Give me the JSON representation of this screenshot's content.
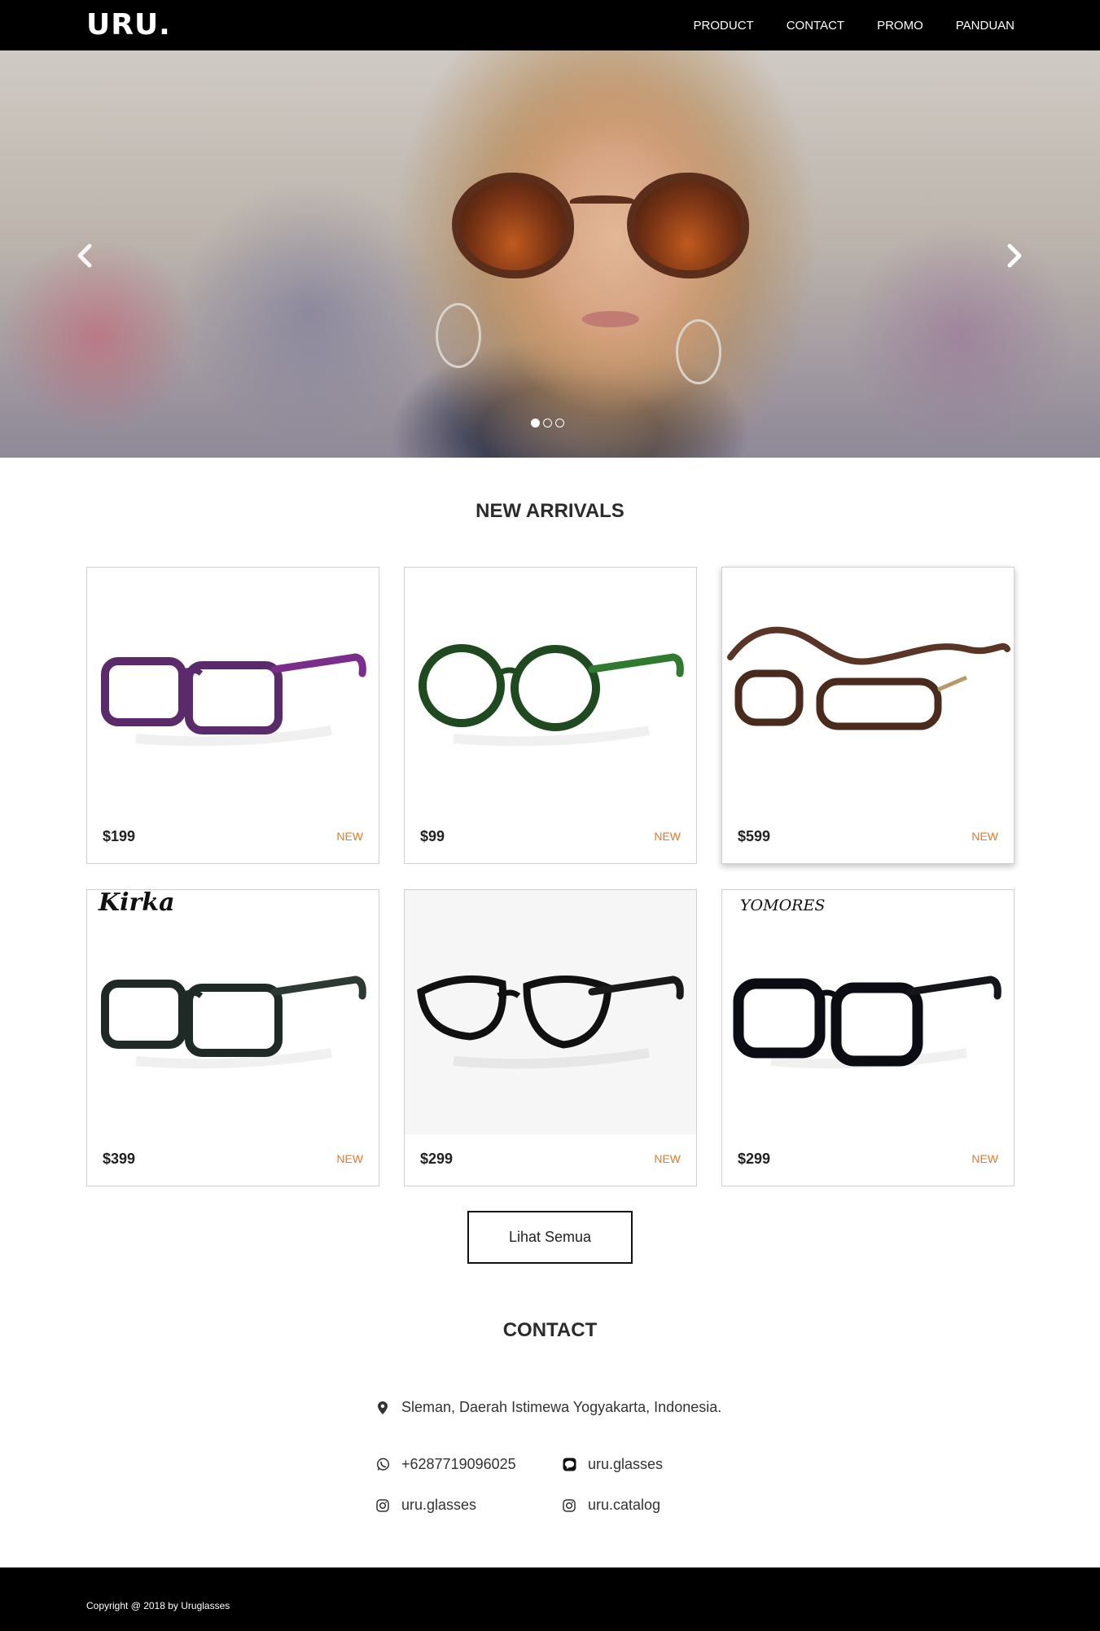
{
  "brand": "URU.",
  "nav": [
    {
      "label": "PRODUCT"
    },
    {
      "label": "CONTACT"
    },
    {
      "label": "PROMO"
    },
    {
      "label": "PANDUAN"
    }
  ],
  "hero": {
    "prev_icon": "chevron-left-icon",
    "next_icon": "chevron-right-icon",
    "slide_count": 3,
    "active_slide": 1
  },
  "new_arrivals": {
    "title": "NEW ARRIVALS",
    "products": [
      {
        "price": "$199",
        "badge": "NEW",
        "frame_color": "#5a2a6a",
        "temple_color": "#7a2d8a",
        "style": "rect"
      },
      {
        "price": "$99",
        "badge": "NEW",
        "frame_color": "#1f4a1f",
        "temple_color": "#2f7a2f",
        "style": "round"
      },
      {
        "price": "$599",
        "badge": "NEW",
        "frame_color": "#4a2a1c",
        "temple_color": "#5a3424",
        "style": "magnetic"
      },
      {
        "price": "$399",
        "badge": "NEW",
        "frame_color": "#1f2a26",
        "temple_color": "#2d3a34",
        "style": "rect",
        "brand_mark": "Kirka"
      },
      {
        "price": "$299",
        "badge": "NEW",
        "frame_color": "#111111",
        "temple_color": "#1a1a1a",
        "style": "cat"
      },
      {
        "price": "$299",
        "badge": "NEW",
        "frame_color": "#0c0c14",
        "temple_color": "#15151c",
        "style": "bold",
        "brand_mark": "YOMORES"
      }
    ],
    "view_all_label": "Lihat Semua"
  },
  "contact": {
    "title": "CONTACT",
    "address": "Sleman, Daerah Istimewa Yogyakarta, Indonesia.",
    "whatsapp": "+6287719096025",
    "line": "uru.glasses",
    "instagram_1": "uru.glasses",
    "instagram_2": "uru.catalog"
  },
  "footer": {
    "copyright": "Copyright @ 2018 by Uruglasses"
  },
  "colors": {
    "nav_bg": "#000000",
    "badge": "#e87722",
    "footer_bg": "#000000"
  }
}
